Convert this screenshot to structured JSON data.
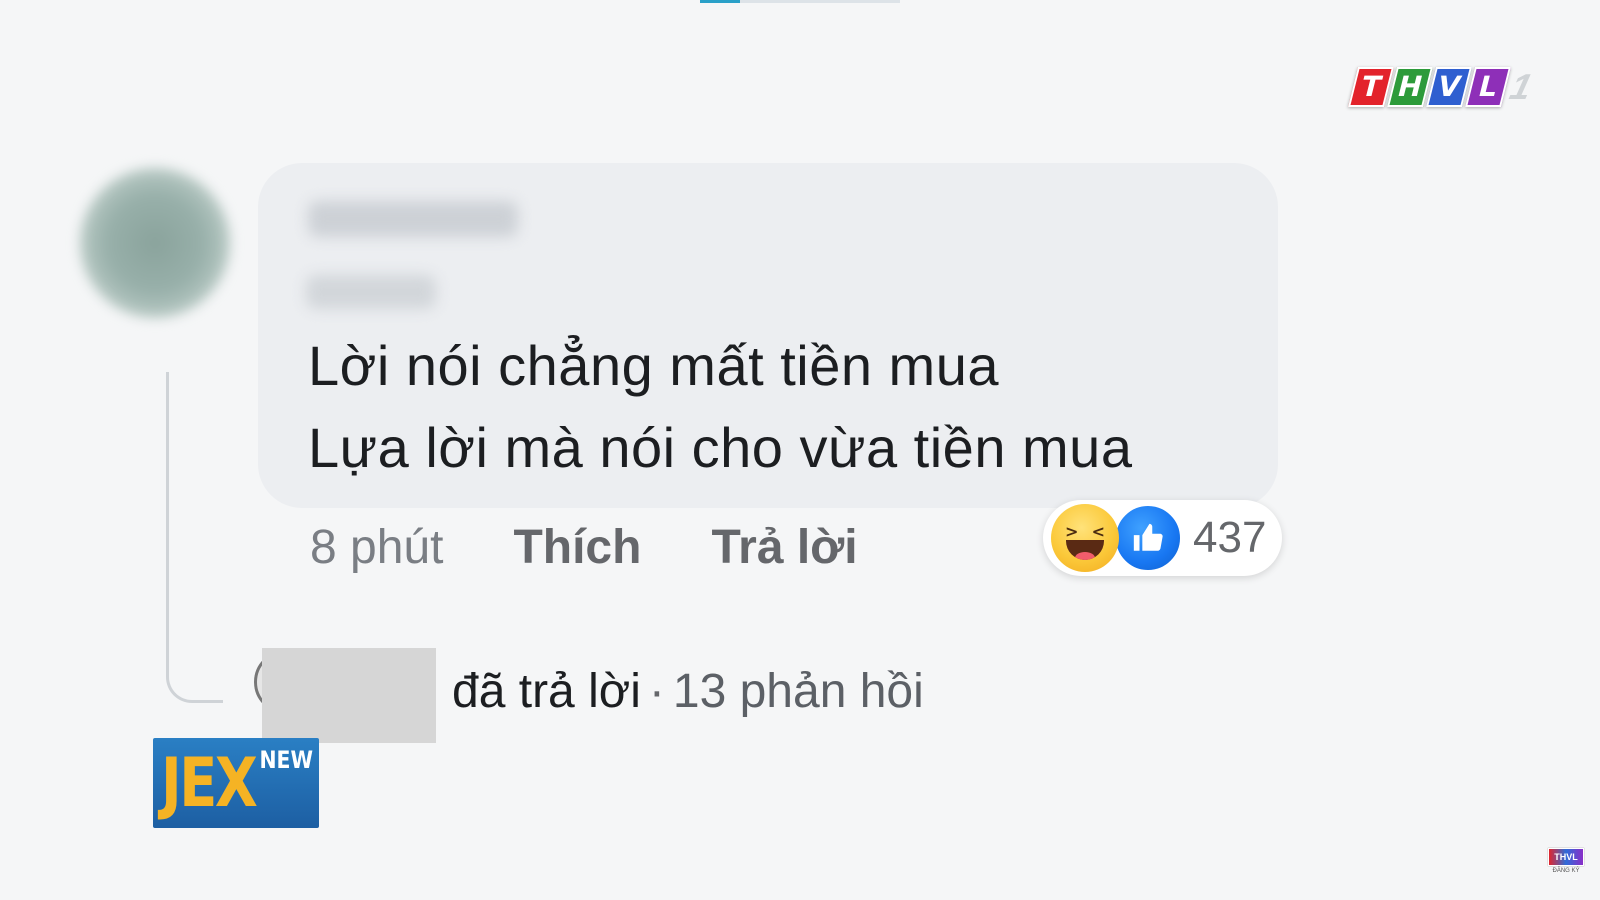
{
  "channel_logo": {
    "letters": [
      "T",
      "H",
      "V",
      "L"
    ],
    "letter_colors": [
      "#e3232b",
      "#2d9b3a",
      "#2f5fd0",
      "#8e2fb8"
    ],
    "number": "1"
  },
  "comment": {
    "lines": [
      "Lời nói chẳng mất tiền mua",
      "Lựa lời mà nói cho vừa tiền mua"
    ],
    "time": "8 phút",
    "like_label": "Thích",
    "reply_label": "Trả lời",
    "reactions": {
      "icons": [
        "haha-icon",
        "like-icon"
      ],
      "count": "437"
    }
  },
  "reply_summary": {
    "action_text": "đã trả lời",
    "separator": "·",
    "count_text": "13 phản hồi"
  },
  "watermark": {
    "brand": "JEX",
    "tag": "NEW"
  },
  "subscribe_corner": {
    "logo_text": "THVL",
    "label": "ĐĂNG KÝ"
  },
  "colors": {
    "bubble_bg": "#eceef1",
    "text_primary": "#1c1e21",
    "text_secondary": "#65676b",
    "like_blue": "#1877f2",
    "haha_yellow": "#fbc93a",
    "jex_blue": "#1d5fa3",
    "jex_orange": "#f5b324"
  }
}
